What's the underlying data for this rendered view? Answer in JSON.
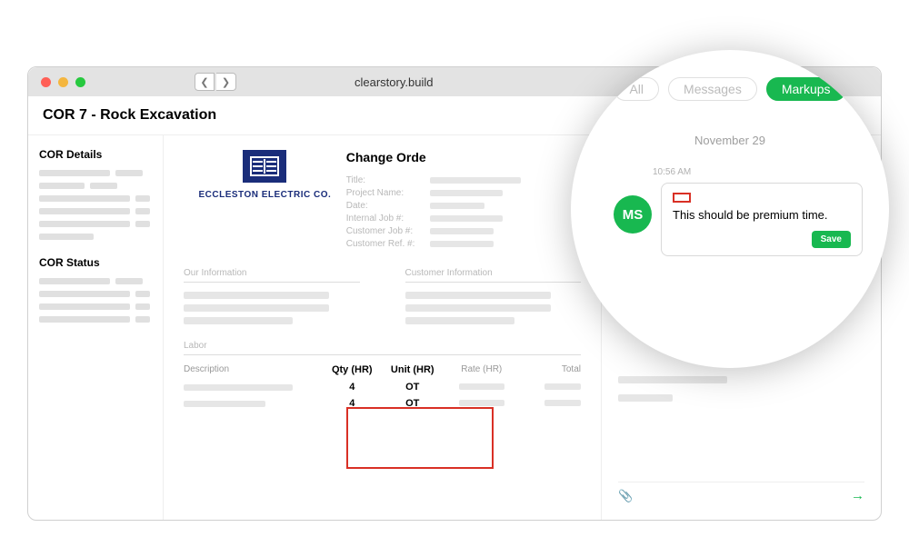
{
  "browser": {
    "url": "clearstory.build"
  },
  "page": {
    "title": "COR 7 - Rock Excavation"
  },
  "sidebar": {
    "details_title": "COR Details",
    "status_title": "COR Status"
  },
  "doc": {
    "company": "ECCLESTON ELECTRIC CO.",
    "doc_title": "Change Orde",
    "meta": {
      "title": "Title:",
      "project_name": "Project Name:",
      "date": "Date:",
      "internal_job": "Internal Job #:",
      "customer_job": "Customer Job #:",
      "customer_ref": "Customer Ref. #:"
    },
    "our_info": "Our Information",
    "customer_info": "Customer Information",
    "labor": {
      "title": "Labor",
      "col_desc": "Description",
      "col_qty": "Qty (HR)",
      "col_unit": "Unit (HR)",
      "col_rate": "Rate (HR)",
      "col_total": "Total",
      "rows": [
        {
          "qty": "4",
          "unit": "OT"
        },
        {
          "qty": "4",
          "unit": "OT"
        }
      ]
    }
  },
  "panel": {
    "tabs": {
      "all": "All",
      "messages": "Messages",
      "markups": "Markups"
    },
    "date": "November 29",
    "time": "10:56 AM",
    "avatar": "MS",
    "message": "This should be premium time.",
    "save": "Save"
  }
}
